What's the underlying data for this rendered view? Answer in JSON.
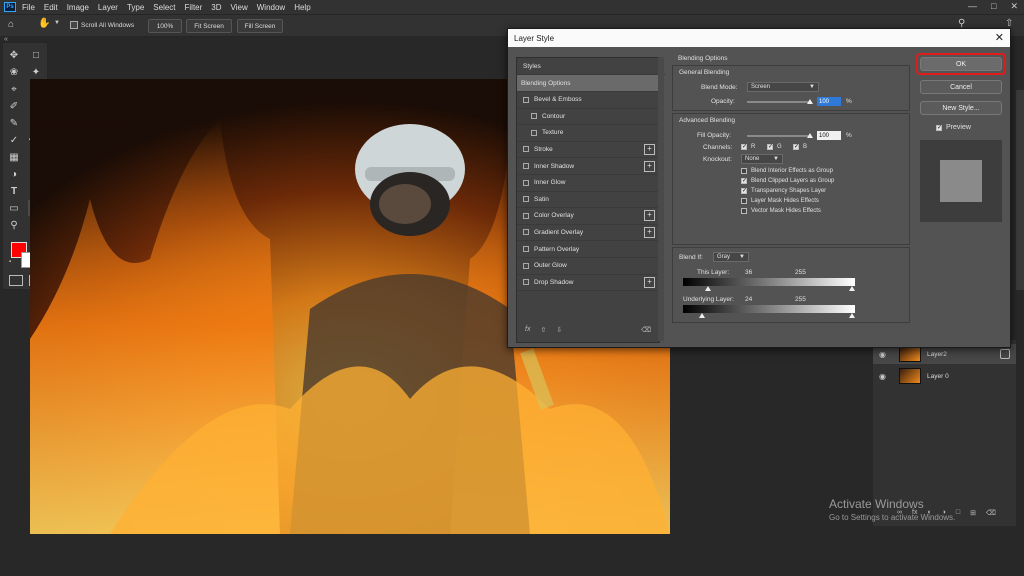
{
  "menu": [
    "File",
    "Edit",
    "Image",
    "Layer",
    "Type",
    "Select",
    "Filter",
    "3D",
    "View",
    "Window",
    "Help"
  ],
  "app_icon": "Ps",
  "options": {
    "scroll_all": "Scroll All Windows",
    "zoom": "100%",
    "fit": "Fit Screen",
    "fill": "Fill Screen"
  },
  "layers": [
    {
      "name": "Layer2"
    },
    {
      "name": "Layer 0"
    }
  ],
  "dialog": {
    "title": "Layer Style",
    "styles_header": "Styles",
    "styles": [
      {
        "label": "Blending Options",
        "checkbox": false,
        "plus": false,
        "selected": true,
        "indent": false
      },
      {
        "label": "Bevel & Emboss",
        "checkbox": true,
        "plus": false,
        "selected": false,
        "indent": false
      },
      {
        "label": "Contour",
        "checkbox": true,
        "plus": false,
        "selected": false,
        "indent": true
      },
      {
        "label": "Texture",
        "checkbox": true,
        "plus": false,
        "selected": false,
        "indent": true
      },
      {
        "label": "Stroke",
        "checkbox": true,
        "plus": true,
        "selected": false,
        "indent": false
      },
      {
        "label": "Inner Shadow",
        "checkbox": true,
        "plus": true,
        "selected": false,
        "indent": false
      },
      {
        "label": "Inner Glow",
        "checkbox": true,
        "plus": false,
        "selected": false,
        "indent": false
      },
      {
        "label": "Satin",
        "checkbox": true,
        "plus": false,
        "selected": false,
        "indent": false
      },
      {
        "label": "Color Overlay",
        "checkbox": true,
        "plus": true,
        "selected": false,
        "indent": false
      },
      {
        "label": "Gradient Overlay",
        "checkbox": true,
        "plus": true,
        "selected": false,
        "indent": false
      },
      {
        "label": "Pattern Overlay",
        "checkbox": true,
        "plus": false,
        "selected": false,
        "indent": false
      },
      {
        "label": "Outer Glow",
        "checkbox": true,
        "plus": false,
        "selected": false,
        "indent": false
      },
      {
        "label": "Drop Shadow",
        "checkbox": true,
        "plus": true,
        "selected": false,
        "indent": false
      }
    ],
    "fx": "fx",
    "blending": {
      "section": "Blending Options",
      "general": "General Blending",
      "blend_mode_label": "Blend Mode:",
      "blend_mode": "Screen",
      "opacity_label": "Opacity:",
      "opacity": "100",
      "advanced": "Advanced Blending",
      "fill_label": "Fill Opacity:",
      "fill": "100",
      "percent": "%",
      "channels_label": "Channels:",
      "channels": [
        "R",
        "G",
        "B"
      ],
      "knockout_label": "Knockout:",
      "knockout": "None",
      "options": [
        {
          "label": "Blend Interior Effects as Group",
          "checked": false
        },
        {
          "label": "Blend Clipped Layers as Group",
          "checked": true
        },
        {
          "label": "Transparency Shapes Layer",
          "checked": true
        },
        {
          "label": "Layer Mask Hides Effects",
          "checked": false
        },
        {
          "label": "Vector Mask Hides Effects",
          "checked": false
        }
      ],
      "blend_if_label": "Blend If:",
      "blend_if": "Gray",
      "this_layer_label": "This Layer:",
      "this_layer_min": "36",
      "this_layer_max": "255",
      "underlying_label": "Underlying Layer:",
      "underlying_min": "24",
      "underlying_max": "255"
    },
    "buttons": {
      "ok": "OK",
      "cancel": "Cancel",
      "new_style": "New Style...",
      "preview": "Preview"
    }
  },
  "watermark": {
    "title": "Activate Windows",
    "subtitle": "Go to Settings to activate Windows."
  },
  "colors": {
    "foreground": "#ff0000",
    "background": "#ffffff",
    "ok_highlight": "#e01c1c"
  }
}
